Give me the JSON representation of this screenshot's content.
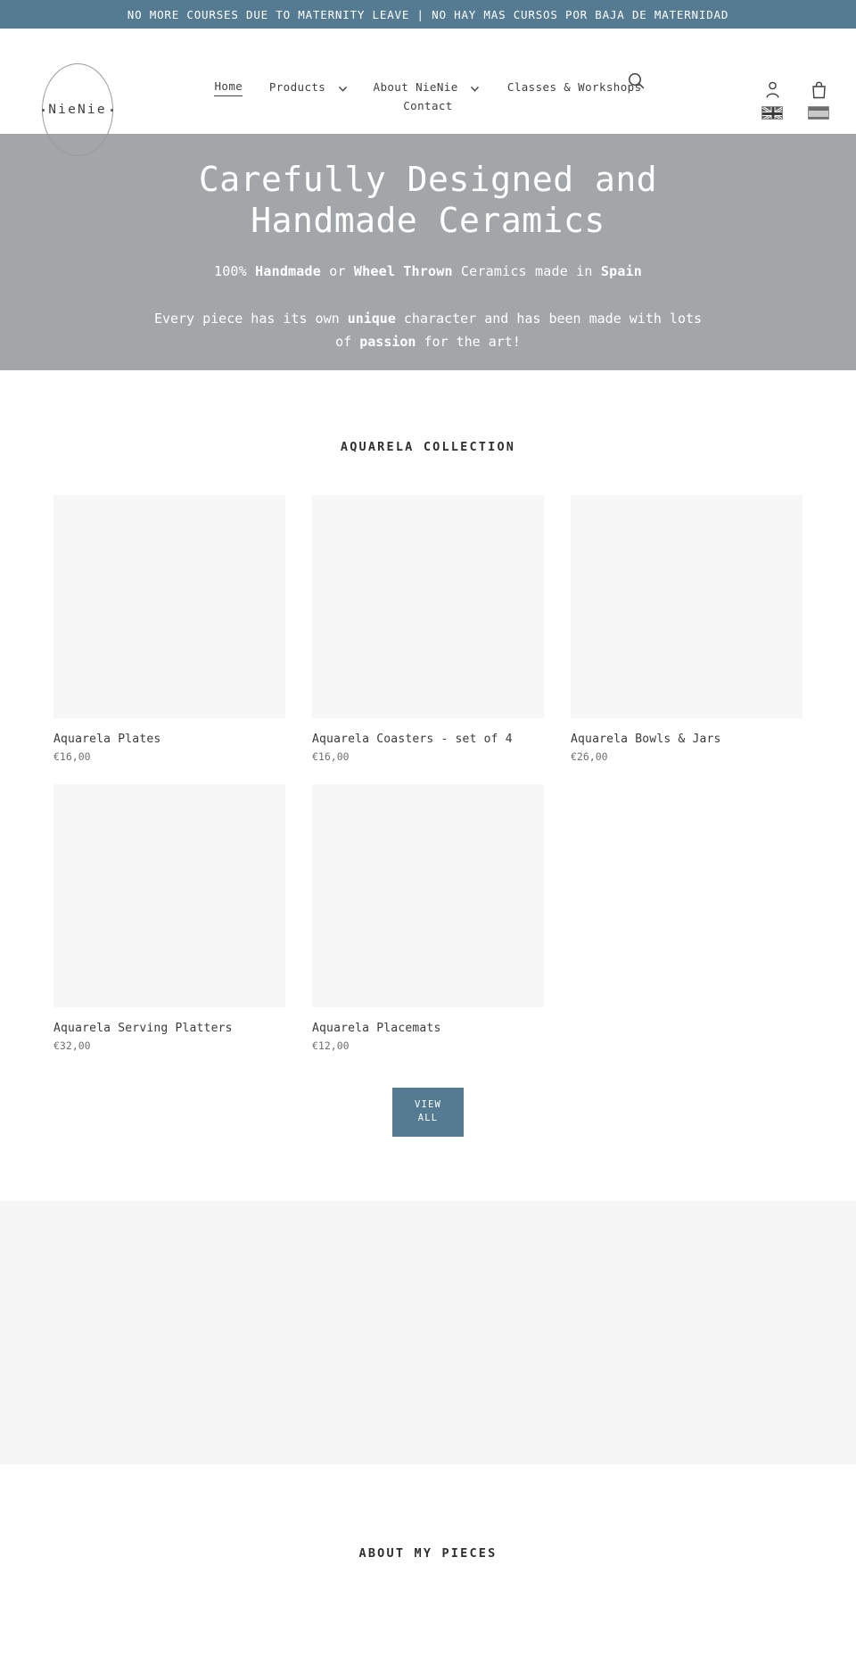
{
  "announcement": {
    "text": "NO MORE COURSES DUE TO MATERNITY LEAVE | NO HAY MAS CURSOS POR BAJA DE MATERNIDAD",
    "background": "#557b93"
  },
  "header": {
    "logo_text": "NieNie",
    "nav": {
      "home": "Home",
      "products": "Products",
      "about": "About NieNie",
      "classes": "Classes & Workshops",
      "contact": "Contact"
    },
    "icons": {
      "search": "search-icon",
      "account": "account-icon",
      "cart": "cart-icon",
      "lang_en": "uk-flag-icon",
      "lang_es": "spain-flag-icon"
    }
  },
  "hero": {
    "title_line1": "Carefully Designed and",
    "title_line2": "Handmade Ceramics",
    "sub": {
      "p1": "100% ",
      "b1": "Handmade",
      "p2": " or ",
      "b2": "Wheel Thrown",
      "p3": " Ceramics made in ",
      "b3": "Spain"
    },
    "body": {
      "p1": "Every piece has its own ",
      "b1": "unique",
      "p2": " character and has been made with lots of ",
      "b2": "passion",
      "p3": " for the art!"
    },
    "background": "#a3a6a8"
  },
  "collection": {
    "title": "AQUARELA COLLECTION",
    "products": [
      {
        "title": "Aquarela Plates",
        "price": "€16,00"
      },
      {
        "title": "Aquarela Coasters - set of 4",
        "price": "€16,00"
      },
      {
        "title": "Aquarela Bowls & Jars",
        "price": "€26,00"
      },
      {
        "title": "Aquarela Serving Platters",
        "price": "€32,00"
      },
      {
        "title": "Aquarela Placemats",
        "price": "€12,00"
      }
    ],
    "view_all_line1": "VIEW",
    "view_all_line2": "ALL",
    "button_color": "#557b93"
  },
  "about": {
    "title": "ABOUT MY PIECES"
  }
}
